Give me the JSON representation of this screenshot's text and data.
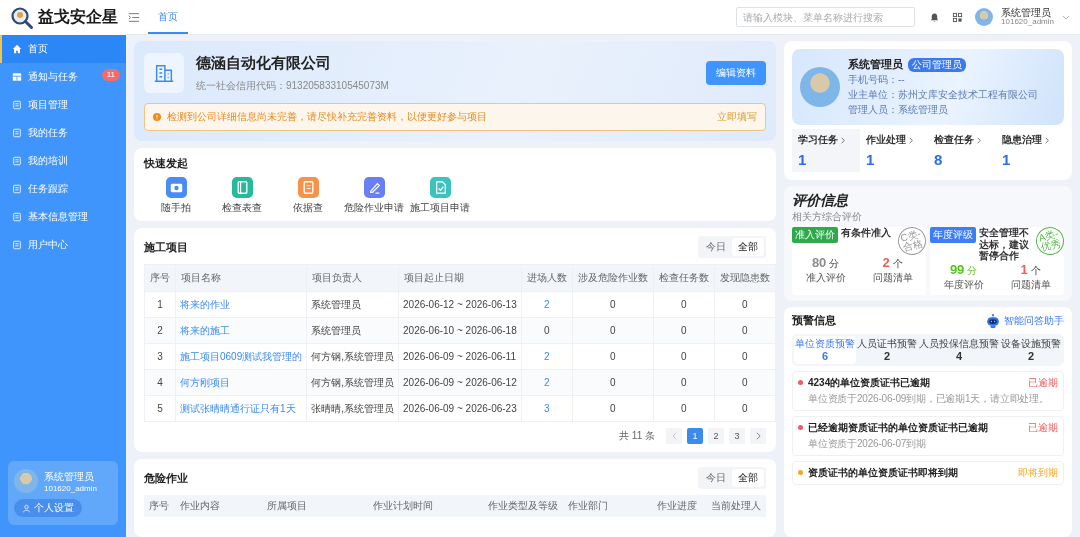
{
  "app": {
    "logo_text": "益戈安企星"
  },
  "sidebar": {
    "items": [
      {
        "label": "首页",
        "selected": true
      },
      {
        "label": "通知与任务",
        "selected": false,
        "badge": "11"
      },
      {
        "label": "项目管理",
        "selected": false
      },
      {
        "label": "我的任务",
        "selected": false
      },
      {
        "label": "我的培训",
        "selected": false
      },
      {
        "label": "任务跟踪",
        "selected": false
      },
      {
        "label": "基本信息管理",
        "selected": false
      },
      {
        "label": "用户中心",
        "selected": false
      }
    ],
    "user": {
      "name": "系统管理员",
      "account": "101620_admin",
      "settings_button": "个人设置"
    }
  },
  "header": {
    "tabs": [
      {
        "label": "首页",
        "selected": true
      }
    ],
    "search": {
      "placeholder": "请输入模块、菜单名称进行搜索"
    },
    "user": {
      "name": "系统管理员",
      "account": "101620_admin"
    }
  },
  "company": {
    "name": "德涵自动化有限公司",
    "credit_code": "统一社会信用代码：91320583310545073M",
    "edit_button": "编辑资料",
    "alert": {
      "text": "检测到公司详细信息尚未完善，请尽快补充完善资料，以便更好参与项目",
      "action": "立即填写"
    }
  },
  "quick_start": {
    "title": "快速发起",
    "items": [
      {
        "label": "随手拍",
        "color": "#4a8cf7"
      },
      {
        "label": "检查表查",
        "color": "#26b99a"
      },
      {
        "label": "依据查",
        "color": "#f7924a"
      },
      {
        "label": "危险作业申请",
        "color": "#6a7ff5"
      },
      {
        "label": "施工项目申请",
        "color": "#3cc3c0"
      }
    ]
  },
  "projects": {
    "title": "施工项目",
    "filters": [
      {
        "label": "今日",
        "selected": false
      },
      {
        "label": "全部",
        "selected": true
      }
    ],
    "columns": [
      "序号",
      "项目名称",
      "项目负责人",
      "项目起止日期",
      "进场人数",
      "涉及危险作业数",
      "检查任务数",
      "发现隐患数"
    ],
    "rows": [
      {
        "index": "1",
        "name": "将来的作业",
        "manager": "系统管理员",
        "dates": "2026-06-12 ~ 2026-06-13",
        "people": "2",
        "people_link": true,
        "hazards": "0",
        "inspections": "0",
        "issues": "0"
      },
      {
        "index": "2",
        "name": "将来的施工",
        "manager": "系统管理员",
        "dates": "2026-06-10 ~ 2026-06-18",
        "people": "0",
        "people_link": false,
        "hazards": "0",
        "inspections": "0",
        "issues": "0"
      },
      {
        "index": "3",
        "name": "施工项目0609测试我管理的",
        "manager": "何方钢,系统管理员",
        "dates": "2026-06-09 ~ 2026-06-11",
        "people": "2",
        "people_link": true,
        "hazards": "0",
        "inspections": "0",
        "issues": "0"
      },
      {
        "index": "4",
        "name": "何方刚项目",
        "manager": "何方钢,系统管理员",
        "dates": "2026-06-09 ~ 2026-06-12",
        "people": "2",
        "people_link": true,
        "hazards": "0",
        "inspections": "0",
        "issues": "0"
      },
      {
        "index": "5",
        "name": "测试张晴晴通行证只有1天",
        "manager": "张晴晴,系统管理员",
        "dates": "2026-06-09 ~ 2026-06-23",
        "people": "3",
        "people_link": true,
        "hazards": "0",
        "inspections": "0",
        "issues": "0"
      }
    ],
    "pagination": {
      "total": "共 11 条",
      "pages": [
        {
          "label": "1",
          "selected": true
        },
        {
          "label": "2",
          "selected": false
        },
        {
          "label": "3",
          "selected": false
        }
      ]
    }
  },
  "hazardous_work": {
    "title": "危险作业",
    "filters": [
      {
        "label": "今日",
        "selected": false
      },
      {
        "label": "全部",
        "selected": true
      }
    ],
    "columns": [
      "序号",
      "作业内容",
      "所属项目",
      "作业计划时间",
      "作业类型及等级",
      "作业部门",
      "作业进度",
      "当前处理人"
    ]
  },
  "profile": {
    "name": "系统管理员",
    "role_badge": "公司管理员",
    "phone": "手机号码：--",
    "owner": "业主单位：苏州文库安全技术工程有限公司",
    "manager": "管理人员：系统管理员",
    "stats": [
      {
        "label": "学习任务",
        "value": "1",
        "selected": true
      },
      {
        "label": "作业处理",
        "value": "1",
        "selected": false
      },
      {
        "label": "检查任务",
        "value": "8",
        "selected": false
      },
      {
        "label": "隐患治理",
        "value": "1",
        "selected": false
      }
    ]
  },
  "evaluation": {
    "title": "评价信息",
    "subtitle": "相关方综合评价",
    "cards": [
      {
        "tag": "准入评价",
        "note": "有条件准入",
        "stamp": "C类-合格",
        "score": "80",
        "score_unit": "分",
        "score_label": "准入评价",
        "issues": "2",
        "issues_unit": "个",
        "issues_label": "问题清单"
      },
      {
        "tag": "年度评级",
        "note": "安全管理不达标，建议暂停合作",
        "stamp": "A类-优秀",
        "score": "99",
        "score_unit": "分",
        "score_label": "年度评价",
        "issues": "1",
        "issues_unit": "个",
        "issues_label": "问题清单"
      }
    ]
  },
  "warnings": {
    "title": "预警信息",
    "tabs": [
      {
        "label": "单位资质预警",
        "count": "6",
        "selected": true
      },
      {
        "label": "人员证书预警",
        "count": "2",
        "selected": false
      },
      {
        "label": "人员投保信息预警",
        "count": "4",
        "selected": false
      },
      {
        "label": "设备设施预警",
        "count": "2",
        "selected": false
      }
    ],
    "items": [
      {
        "title": "4234的单位资质证书已逾期",
        "detail": "单位资质于2026-06-09到期，已逾期1天，请立即处理。",
        "status": "已逾期",
        "color": "#f05b5b"
      },
      {
        "title": "已经逾期资质证书的单位资质证书已逾期",
        "detail": "单位资质于2026-06-07到期",
        "status": "已逾期",
        "color": "#f05b5b"
      },
      {
        "title": "资质证书的单位资质证书即将到期",
        "status": "即将到期",
        "color": "#f5a623"
      }
    ]
  },
  "assistant": {
    "label": "智能问答助手"
  }
}
